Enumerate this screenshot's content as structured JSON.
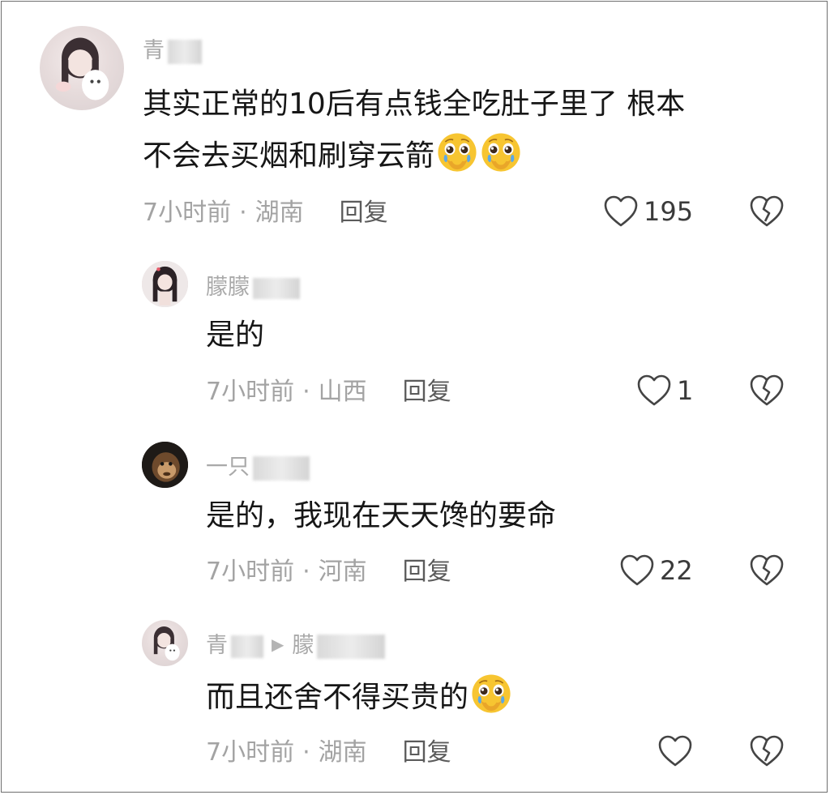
{
  "comments": [
    {
      "author": "青",
      "text_line1": "其实正常的10后有点钱全吃肚子里了 根本",
      "text_line2": "不会去买烟和刷穿云箭",
      "emojis": [
        "pleading-crying-face",
        "pleading-crying-face"
      ],
      "time": "7小时前",
      "location": "湖南",
      "reply_label": "回复",
      "likes": "195"
    },
    {
      "author": "朦朦",
      "text": "是的",
      "time": "7小时前",
      "location": "山西",
      "reply_label": "回复",
      "likes": "1"
    },
    {
      "author": "一只",
      "text": "是的，我现在天天馋的要命",
      "time": "7小时前",
      "location": "河南",
      "reply_label": "回复",
      "likes": "22"
    },
    {
      "author": "青",
      "reply_to": "朦",
      "text": "而且还舍不得买贵的",
      "emojis": [
        "pleading-crying-face"
      ],
      "time": "7小时前",
      "location": "湖南",
      "reply_label": "回复",
      "likes": ""
    }
  ],
  "separator": "·",
  "colors": {
    "text": "#161616",
    "meta": "#a3a3a3",
    "name": "#a9a9a9",
    "emoji": "#f7c531"
  }
}
